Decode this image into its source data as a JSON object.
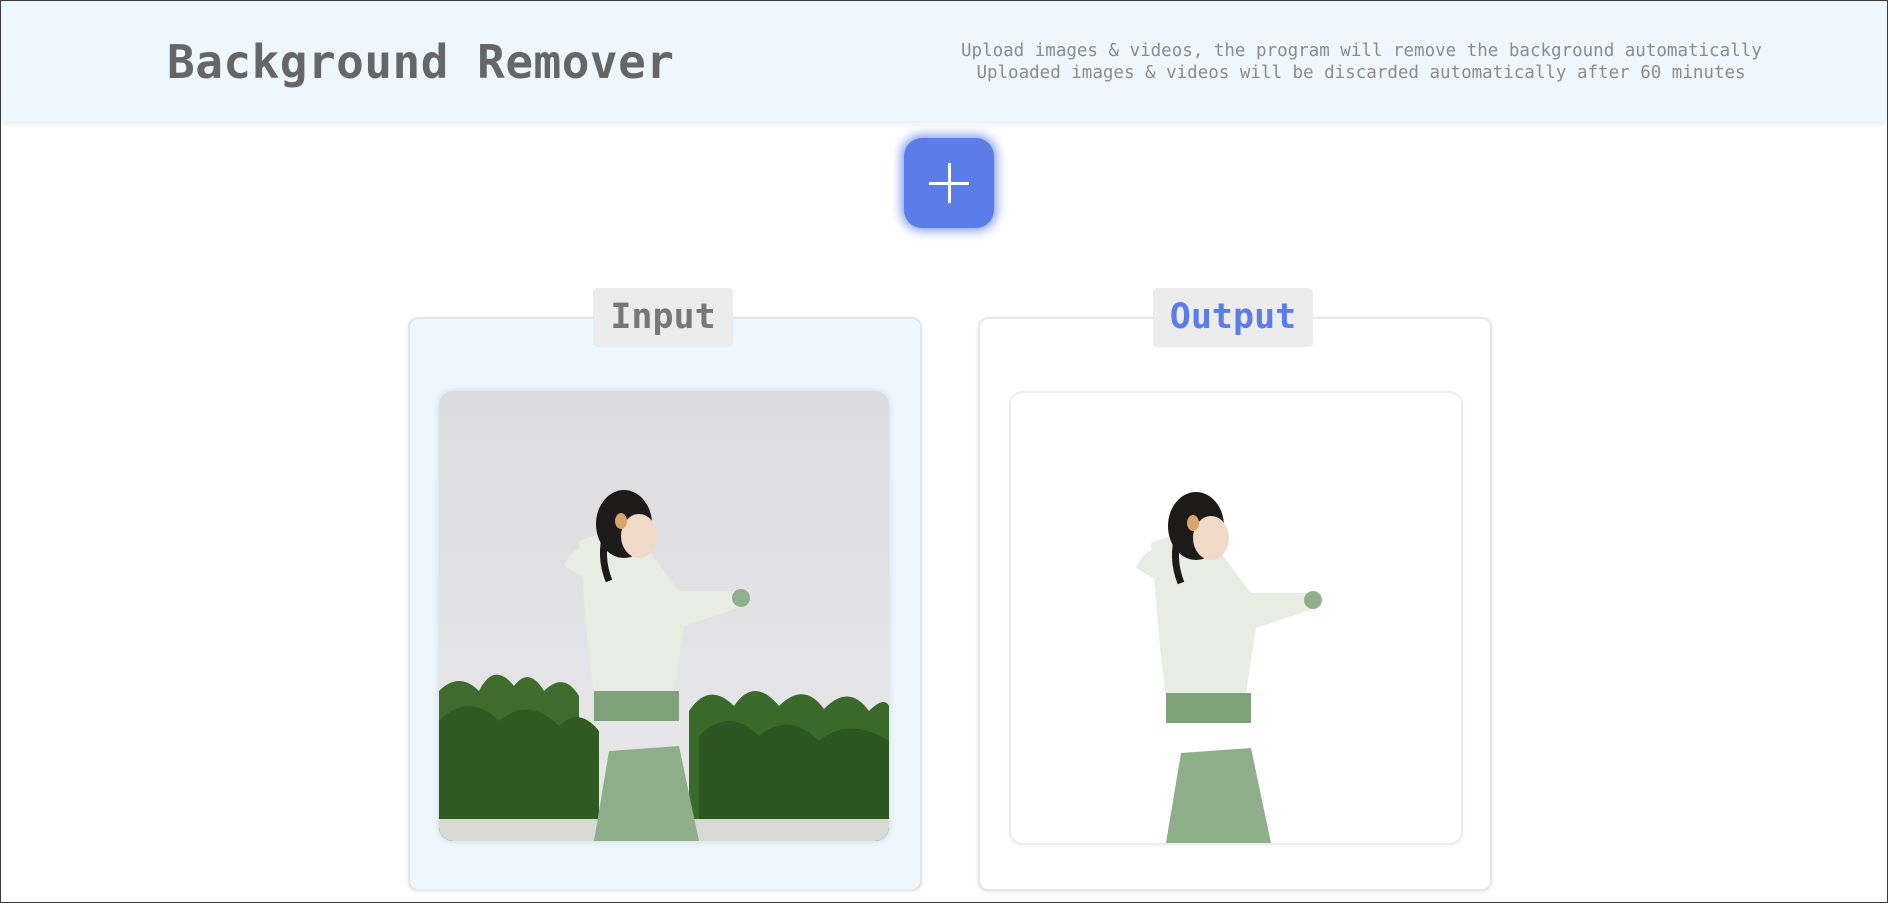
{
  "header": {
    "title": "Background Remover",
    "info_lines": [
      "Upload images & videos, the program will remove the background automatically",
      "Uploaded images & videos will be discarded automatically after 60 minutes"
    ]
  },
  "upload_button": {
    "icon": "plus-icon"
  },
  "panels": {
    "input": {
      "label": "Input",
      "image": "photo of a young girl in a green knit sweater and skirt in front of a white wall and green shrubs"
    },
    "output": {
      "label": "Output",
      "image": "same girl with the background removed"
    }
  },
  "colors": {
    "accent": "#5b7de8",
    "header_bg": "#eef6fe",
    "title_text": "#666666",
    "label_bg": "#ececec"
  }
}
